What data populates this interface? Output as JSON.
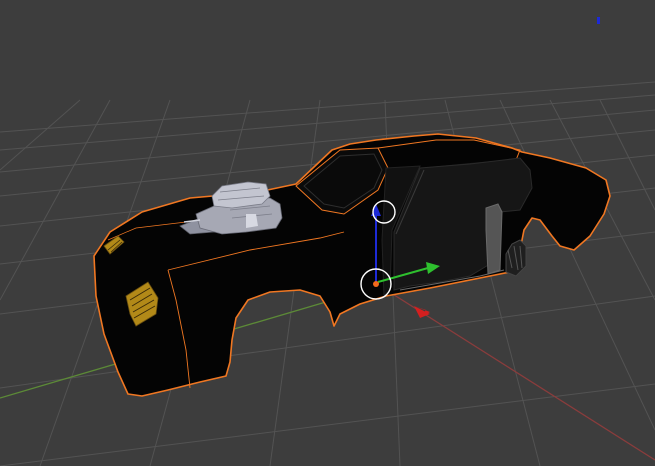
{
  "viewport": {
    "kind": "3d-viewport",
    "background": "#3d3d3d",
    "grid_color": "#535353",
    "x_axis_color": "#8a3c3c",
    "y_axis_color": "#5c8a37"
  },
  "selection": {
    "object": "car-body",
    "outline_color": "#f07722",
    "body_color": "#040404",
    "engine_color": "#a6a8b4",
    "vent_color": "#b28918"
  },
  "manipulator": {
    "mode": "translate",
    "x_color": "#d41f1f",
    "y_color": "#2ec02e",
    "z_color": "#1d2ad6",
    "origin_color": "#f26a1d",
    "ring_color": "#ffffff"
  },
  "mini_axis": {
    "color": "#1d2ad6"
  }
}
